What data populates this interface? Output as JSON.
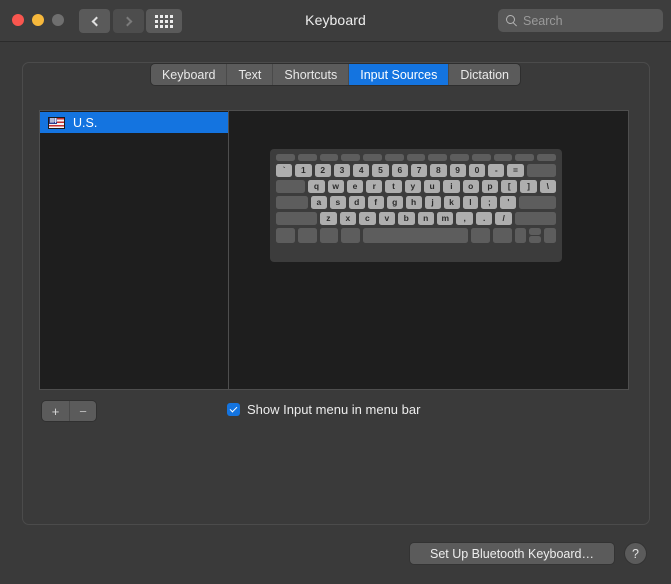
{
  "window": {
    "title": "Keyboard",
    "traffic_lights": [
      "close",
      "minimize",
      "zoom"
    ]
  },
  "toolbar": {
    "back_icon": "chevron-left-icon",
    "forward_icon": "chevron-right-icon",
    "show_all_icon": "grid-dots-icon",
    "search": {
      "placeholder": "Search",
      "value": "",
      "icon": "search-icon"
    }
  },
  "tabs": [
    {
      "label": "Keyboard",
      "active": false
    },
    {
      "label": "Text",
      "active": false
    },
    {
      "label": "Shortcuts",
      "active": false
    },
    {
      "label": "Input Sources",
      "active": true
    },
    {
      "label": "Dictation",
      "active": false
    }
  ],
  "input_sources": {
    "items": [
      {
        "label": "U.S.",
        "icon": "us-flag-icon",
        "selected": true
      }
    ],
    "add_label": "+",
    "remove_label": "−"
  },
  "keyboard_preview": {
    "rows": [
      {
        "name": "function-row",
        "keys": [
          "",
          "",
          "",
          "",
          "",
          "",
          "",
          "",
          "",
          "",
          "",
          "",
          ""
        ]
      },
      {
        "name": "number-row",
        "keys": [
          "`",
          "1",
          "2",
          "3",
          "4",
          "5",
          "6",
          "7",
          "8",
          "9",
          "0",
          "-",
          "=",
          ""
        ]
      },
      {
        "name": "qwerty-row",
        "keys": [
          "",
          "q",
          "w",
          "e",
          "r",
          "t",
          "y",
          "u",
          "i",
          "o",
          "p",
          "[",
          "]",
          "\\"
        ]
      },
      {
        "name": "home-row",
        "keys": [
          "",
          "a",
          "s",
          "d",
          "f",
          "g",
          "h",
          "j",
          "k",
          "l",
          ";",
          "'",
          ""
        ]
      },
      {
        "name": "zxcv-row",
        "keys": [
          "",
          "z",
          "x",
          "c",
          "v",
          "b",
          "n",
          "m",
          ",",
          ".",
          "/",
          ""
        ]
      },
      {
        "name": "modifier-row",
        "keys": [
          "",
          "",
          "",
          "",
          "",
          "",
          "",
          "",
          "",
          ""
        ]
      }
    ]
  },
  "options": {
    "show_input_menu": {
      "label": "Show Input menu in menu bar",
      "checked": true
    }
  },
  "footer": {
    "bluetooth_button": "Set Up Bluetooth Keyboard…",
    "help_label": "?"
  },
  "colors": {
    "accent": "#1474e0",
    "window_bg": "#3a3a3a",
    "listbox_bg": "#1e1e1e",
    "key_lit": "#aeaeae",
    "key_blank": "#5d5d5d"
  }
}
